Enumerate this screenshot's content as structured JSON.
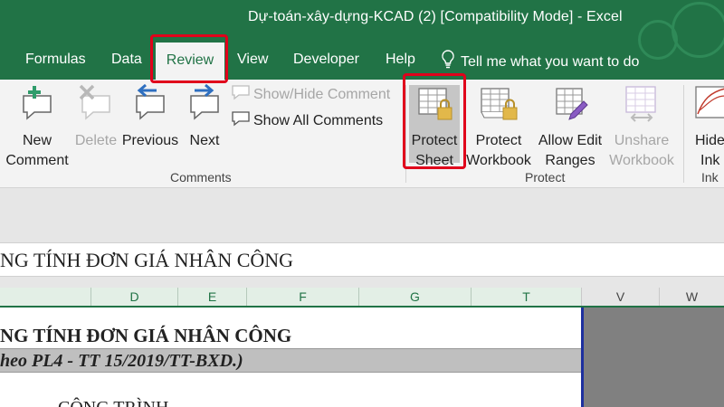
{
  "window": {
    "title": "Dự-toán-xây-dựng-KCAD (2)  [Compatibility Mode]  -  Excel"
  },
  "tabs": [
    {
      "label": "Formulas"
    },
    {
      "label": "Data"
    },
    {
      "label": "Review"
    },
    {
      "label": "View"
    },
    {
      "label": "Developer"
    },
    {
      "label": "Help"
    }
  ],
  "tell_me": "Tell me what you want to do",
  "ribbon": {
    "comments": {
      "new_comment": [
        "New",
        "Comment"
      ],
      "delete": "Delete",
      "previous": "Previous",
      "next": "Next",
      "show_hide_comment": "Show/Hide Comment",
      "show_all_comments": "Show All Comments",
      "group_label": "Comments"
    },
    "protect": {
      "protect_sheet": [
        "Protect",
        "Sheet"
      ],
      "protect_workbook": [
        "Protect",
        "Workbook"
      ],
      "allow_edit_ranges": [
        "Allow Edit",
        "Ranges"
      ],
      "unshare_workbook": [
        "Unshare",
        "Workbook"
      ],
      "group_label": "Protect"
    },
    "ink": {
      "hide_ink": [
        "Hide",
        "Ink"
      ],
      "group_label": "Ink"
    }
  },
  "formula_bar": {
    "content": "NG TÍNH ĐƠN GIÁ NHÂN CÔNG"
  },
  "columns": [
    "D",
    "E",
    "F",
    "G",
    "T",
    "V",
    "W"
  ],
  "sheet": {
    "row1": "NG TÍNH ĐƠN GIÁ NHÂN CÔNG",
    "row2": "heo PL4 - TT 15/2019/TT-BXD.)",
    "row3": "CÔNG TRÌNH"
  },
  "colors": {
    "excel_green": "#217346",
    "highlight_red": "#e0001b",
    "locked_area": "#808080"
  },
  "icons": {
    "new_comment": "new-comment-icon",
    "delete": "delete-comment-icon",
    "previous": "previous-comment-icon",
    "next": "next-comment-icon",
    "protect_sheet": "protect-sheet-icon",
    "protect_workbook": "protect-workbook-icon",
    "allow_edit_ranges": "allow-edit-ranges-icon",
    "unshare_workbook": "unshare-workbook-icon",
    "hide_ink": "hide-ink-icon",
    "tell_me": "lightbulb-icon"
  }
}
